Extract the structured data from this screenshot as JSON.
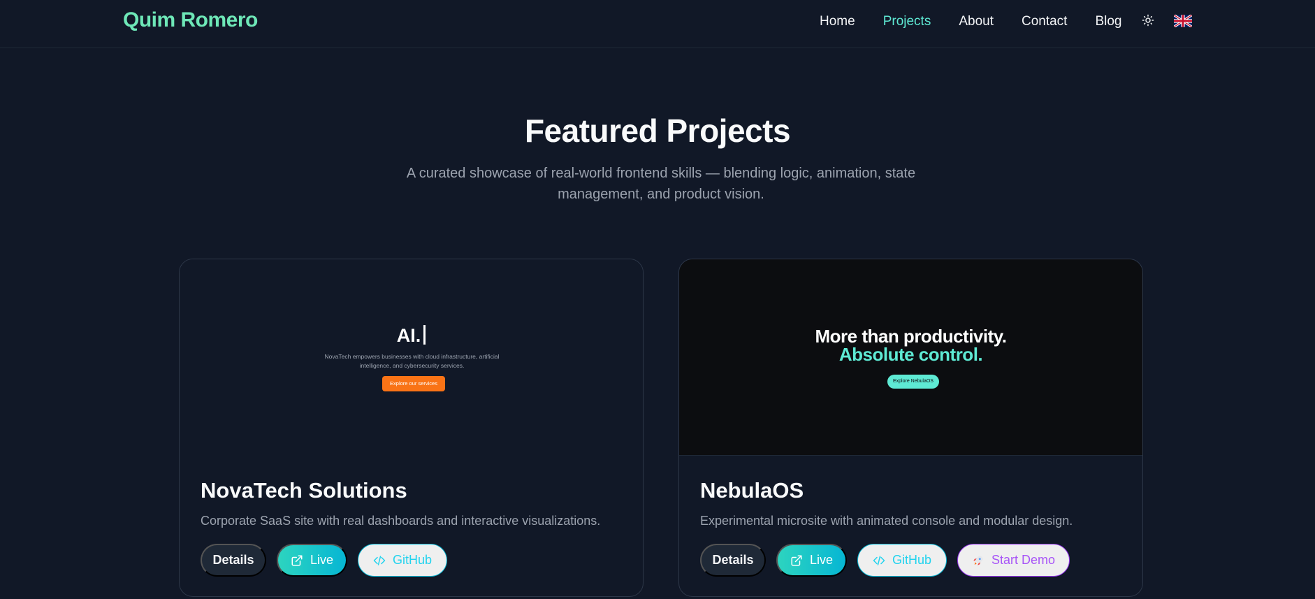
{
  "header": {
    "brand": "Quim Romero",
    "nav": [
      {
        "label": "Home"
      },
      {
        "label": "Projects",
        "active": true
      },
      {
        "label": "About"
      },
      {
        "label": "Contact"
      },
      {
        "label": "Blog"
      }
    ],
    "theme_icon": "sun-icon",
    "language_icon": "uk-flag-icon"
  },
  "hero": {
    "title": "Featured Projects",
    "subtitle": "A curated showcase of real-world frontend skills — blending logic, animation, state management, and product vision."
  },
  "projects": [
    {
      "title": "NovaTech Solutions",
      "description": "Corporate SaaS site with real dashboards and interactive visualizations.",
      "preview": {
        "heading": "AI.",
        "text": "NovaTech empowers businesses with cloud infrastructure, artificial intelligence, and cybersecurity services.",
        "button": "Explore our services"
      },
      "buttons": {
        "details": "Details",
        "live": "Live",
        "github": "GitHub"
      }
    },
    {
      "title": "NebulaOS",
      "description": "Experimental microsite with animated console and modular design.",
      "preview": {
        "line1": "More than productivity.",
        "line2": "Absolute control.",
        "button": "Explore NebulaOS"
      },
      "buttons": {
        "details": "Details",
        "live": "Live",
        "github": "GitHub",
        "demo": "Start Demo"
      }
    }
  ],
  "colors": {
    "background": "#111827",
    "brand": "#6ee7b7",
    "accent": "#5eead4",
    "cyan": "#06b6d4",
    "purple": "#a855f7",
    "orange": "#f97316"
  }
}
